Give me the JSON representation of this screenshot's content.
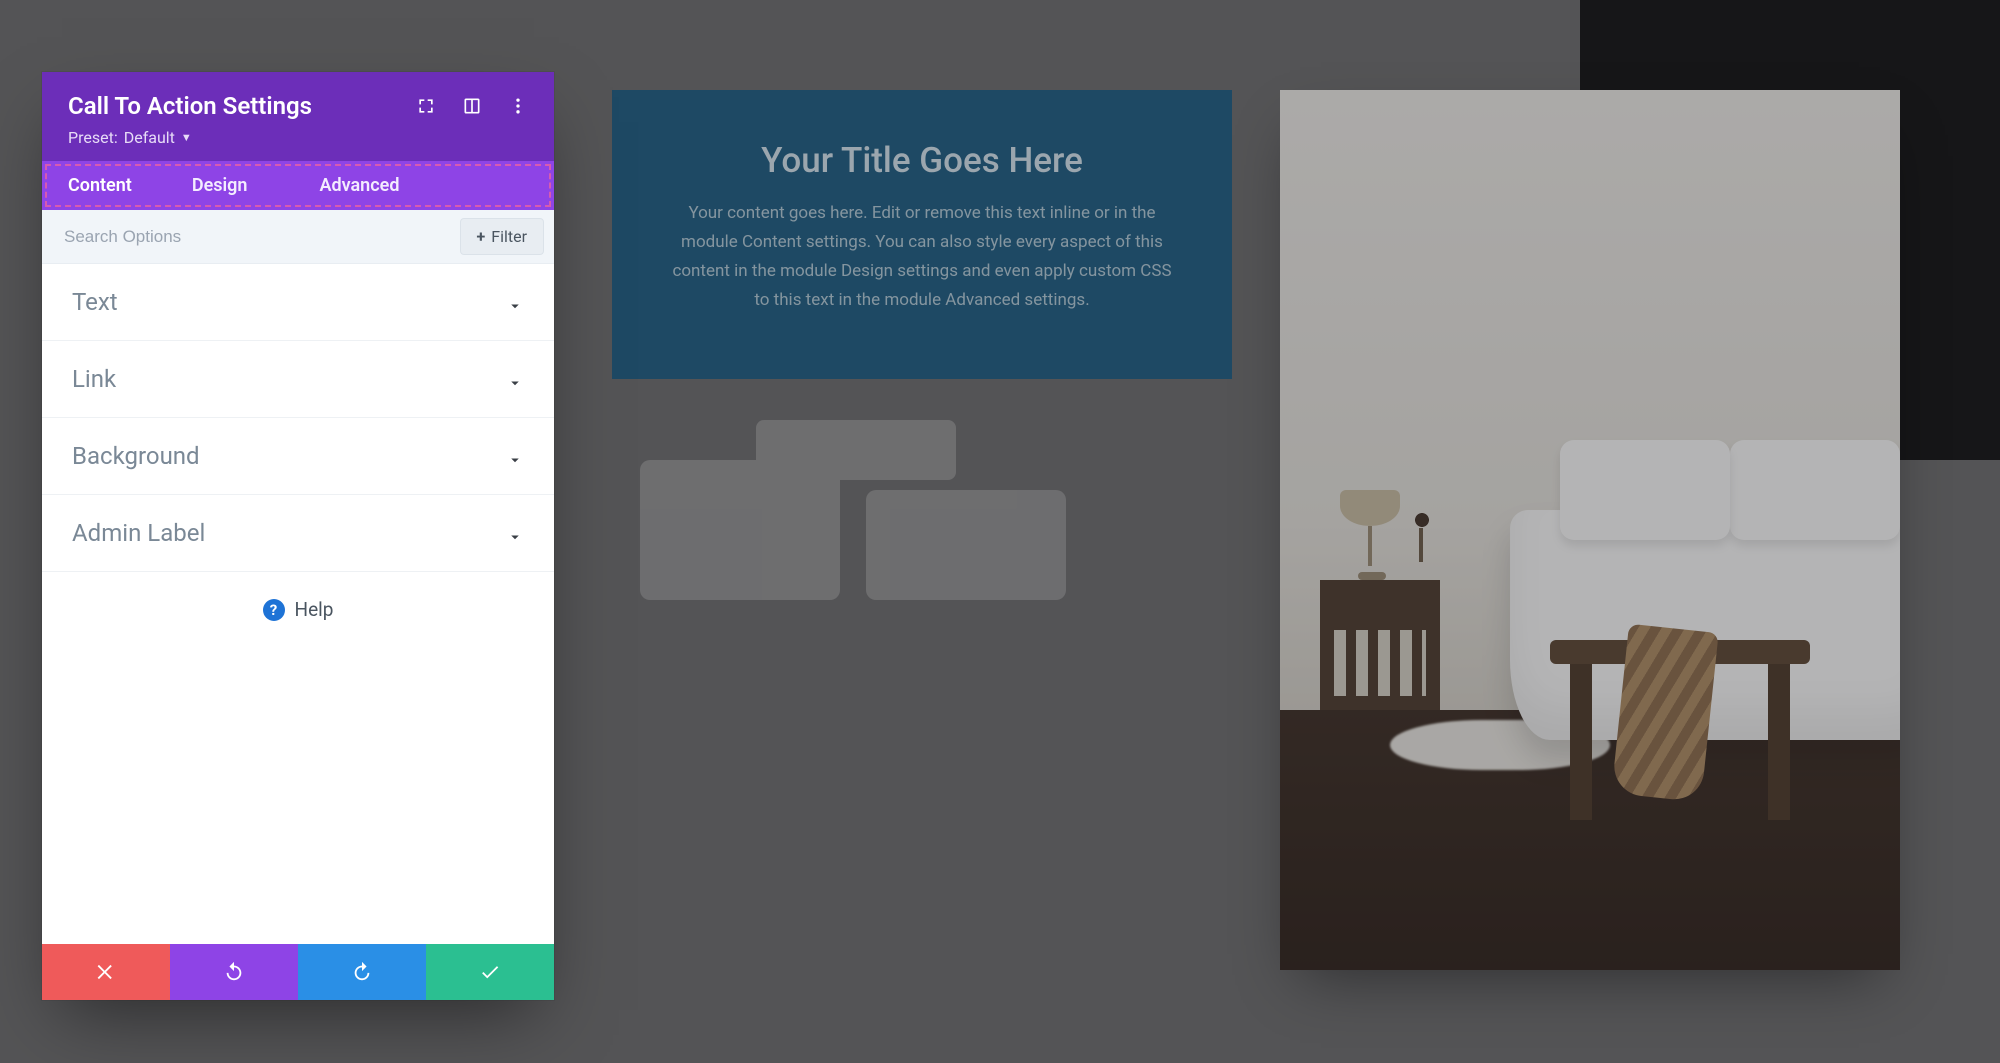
{
  "panel": {
    "title": "Call To Action Settings",
    "preset_label": "Preset:",
    "preset_value": "Default",
    "tabs": [
      "Content",
      "Design",
      "Advanced"
    ],
    "active_tab": 0,
    "search_placeholder": "Search Options",
    "filter_label": "Filter",
    "options": [
      "Text",
      "Link",
      "Background",
      "Admin Label"
    ],
    "help_label": "Help"
  },
  "cta": {
    "title": "Your Title Goes Here",
    "body": "Your content goes here. Edit or remove this text inline or in the module Content settings. You can also style every aspect of this content in the module Design settings and even apply custom CSS to this text in the module Advanced settings."
  },
  "colors": {
    "panel_purple": "#6c2eb9",
    "tabs_purple": "#8e44e6",
    "cta_bg": "#195b83",
    "save_green": "#2bbf91",
    "redo_blue": "#2a8fe6",
    "cancel_red": "#ef5a5a"
  }
}
